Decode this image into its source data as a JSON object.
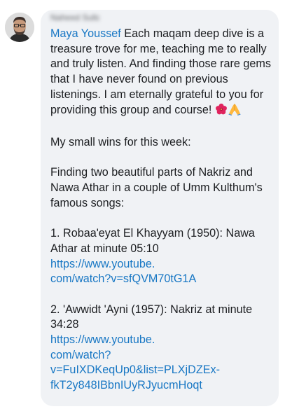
{
  "comment": {
    "author_name_blurred": "Naheed Sultan",
    "mention": "Maya Youssef",
    "intro": " Each maqam deep dive is a treasure trove for me, teaching me to really and truly listen. And finding those rare gems that I have never found on previous listenings.  I am eternally grateful to you for providing this group and course! ",
    "intro_emoji_1": "hibiscus-emoji",
    "intro_emoji_2": "folded-hands-emoji",
    "wins_heading": "My small wins for this week:",
    "finding": "Finding two beautiful parts of Nakriz and Nawa Athar in a couple of Umm Kulthum's famous songs:",
    "item1_text": "1. Robaa'eyat El Khayyam (1950): Nawa Athar at minute 05:10",
    "item1_link_line1": "https://www.youtube.",
    "item1_link_line2": "com/watch?v=sfQVM70tG1A",
    "item2_text": "2.  'Awwidt 'Ayni (1957): Nakriz at minute 34:28",
    "item2_link_line1": "https://www.youtube.",
    "item2_link_line2": "com/watch?v=FuIXDKeqUp0&list=PLXjDZEx-fkT2y848IBbnIUyRJyucmHoqt"
  },
  "colors": {
    "bubble_bg": "#f0f2f5",
    "text": "#1c1e21",
    "link": "#1877c4"
  }
}
